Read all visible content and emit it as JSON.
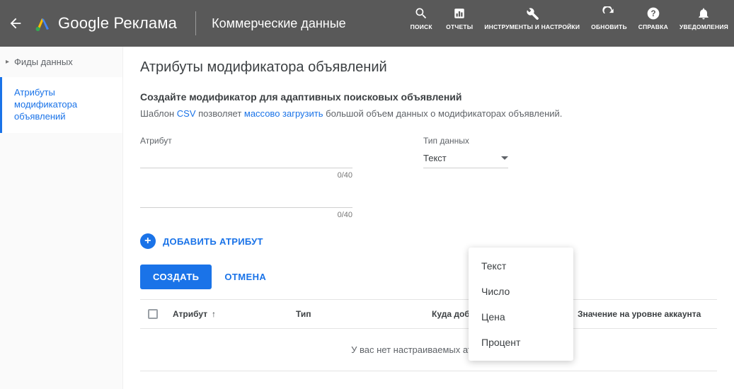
{
  "header": {
    "product": "Google Реклама",
    "section": "Коммерческие данные",
    "tools": {
      "search": "ПОИСК",
      "reports": "ОТЧЕТЫ",
      "tools_settings": "ИНСТРУМЕНТЫ И НАСТРОЙКИ",
      "refresh": "ОБНОВИТЬ",
      "help": "СПРАВКА",
      "notifications": "УВЕДОМЛЕНИЯ"
    }
  },
  "sidebar": {
    "item_feeds": "Фиды данных",
    "item_attributes": "Атрибуты модификатора объявлений"
  },
  "page": {
    "title": "Атрибуты модификатора объявлений",
    "sub_title": "Создайте модификатор для адаптивных поисковых объявлений",
    "desc_prefix": "Шаблон ",
    "desc_link_csv": "CSV",
    "desc_mid": " позволяет ",
    "desc_link_upload": "массово загрузить",
    "desc_suffix": " большой объем данных о модификаторах объявлений."
  },
  "form": {
    "attribute_label": "Атрибут",
    "datatype_label": "Тип данных",
    "datatype_selected": "Текст",
    "counter1": "0/40",
    "counter2": "0/40",
    "add_attribute": "ДОБАВИТЬ АТРИБУТ",
    "create": "СОЗДАТЬ",
    "cancel": "ОТМЕНА",
    "options": {
      "text": "Текст",
      "number": "Число",
      "price": "Цена",
      "percent": "Процент"
    }
  },
  "table": {
    "col_attribute": "Атрибут",
    "col_type": "Тип",
    "col_where": "Куда добавлено",
    "col_account_value": "Значение на уровне аккаунта",
    "empty": "У вас нет настраиваемых атрибутов"
  }
}
